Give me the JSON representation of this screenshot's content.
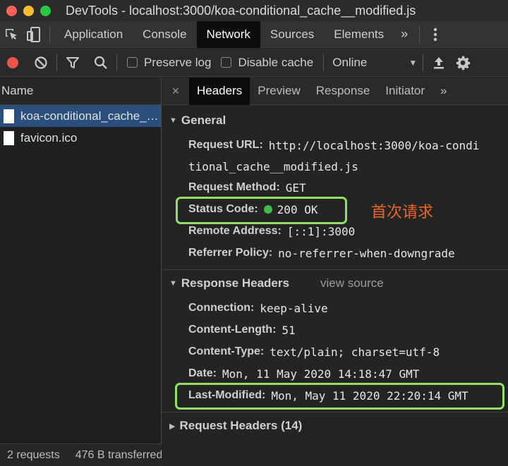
{
  "window": {
    "title": "DevTools - localhost:3000/koa-conditional_cache__modified.js"
  },
  "main_tabs": {
    "items": [
      "Application",
      "Console",
      "Network",
      "Sources",
      "Elements"
    ],
    "active": "Network",
    "more": "»"
  },
  "toolbar": {
    "preserve_log": "Preserve log",
    "disable_cache": "Disable cache",
    "throttle": "Online"
  },
  "requests": {
    "header": "Name",
    "items": [
      "koa-conditional_cache__modified.js",
      "favicon.ico"
    ],
    "status": {
      "count": "2 requests",
      "transferred": "476 B transferred"
    }
  },
  "detail_tabs": {
    "close": "×",
    "items": [
      "Headers",
      "Preview",
      "Response",
      "Initiator"
    ],
    "active": "Headers",
    "more": "»"
  },
  "general": {
    "title": "General",
    "request_url_key": "Request URL:",
    "request_url_line1": "http://localhost:3000/koa-condi",
    "request_url_line2": "tional_cache__modified.js",
    "request_method_key": "Request Method:",
    "request_method": "GET",
    "status_code_key": "Status Code:",
    "status_code": "200 OK",
    "remote_address_key": "Remote Address:",
    "remote_address": "[::1]:3000",
    "referrer_policy_key": "Referrer Policy:",
    "referrer_policy": "no-referrer-when-downgrade"
  },
  "annotation": "首次请求",
  "response_headers": {
    "title": "Response Headers",
    "view_source": "view source",
    "connection_key": "Connection:",
    "connection": "keep-alive",
    "content_length_key": "Content-Length:",
    "content_length": "51",
    "content_type_key": "Content-Type:",
    "content_type": "text/plain; charset=utf-8",
    "date_key": "Date:",
    "date": "Mon, 11 May 2020 14:18:47 GMT",
    "last_modified_key": "Last-Modified:",
    "last_modified": "Mon, May 11 2020 22:20:14 GMT"
  },
  "request_headers": {
    "title": "Request Headers (14)"
  },
  "colors": {
    "highlight": "#94e064",
    "annotation": "#e8662a",
    "status_ok": "#43b94a",
    "selection": "#2a4f7d"
  }
}
